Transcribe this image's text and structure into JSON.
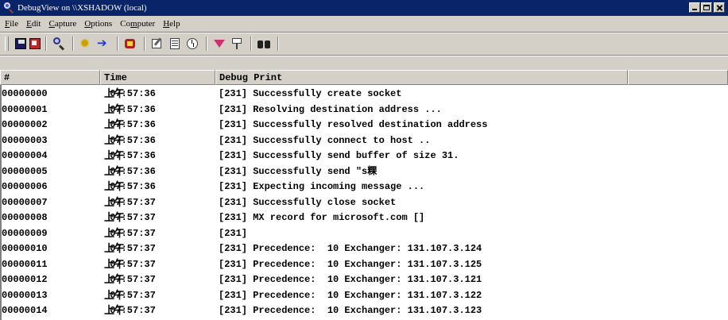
{
  "window": {
    "title": "DebugView on \\\\XSHADOW (local)"
  },
  "menu": [
    {
      "accel": "F",
      "rest": "ile"
    },
    {
      "accel": "E",
      "rest": "dit"
    },
    {
      "accel": "C",
      "rest": "apture"
    },
    {
      "accel": "O",
      "rest": "ptions"
    },
    {
      "pre": "Co",
      "accel": "m",
      "rest": "puter"
    },
    {
      "accel": "H",
      "rest": "elp"
    }
  ],
  "toolbar": {
    "icons": [
      "save-icon",
      "clear-display-icon",
      "find-icon",
      "capture-gear-icon",
      "capture-arrow-icon",
      "capture-kernel-icon",
      "edit-icon",
      "log-icon",
      "clock-icon",
      "filter-icon",
      "highlight-icon",
      "binoculars-icon"
    ]
  },
  "columns": {
    "num": "#",
    "time": "Time",
    "msg": "Debug Print"
  },
  "rows": [
    {
      "num": "00000000",
      "ampm": "上午",
      "time": "07:57:36",
      "msg": "[231] Successfully create socket"
    },
    {
      "num": "00000001",
      "ampm": "上午",
      "time": "07:57:36",
      "msg": "[231] Resolving destination address ..."
    },
    {
      "num": "00000002",
      "ampm": "上午",
      "time": "07:57:36",
      "msg": "[231] Successfully resolved destination address"
    },
    {
      "num": "00000003",
      "ampm": "上午",
      "time": "07:57:36",
      "msg": "[231] Successfully connect to host .."
    },
    {
      "num": "00000004",
      "ampm": "上午",
      "time": "07:57:36",
      "msg": "[231] Successfully send buffer of size 31."
    },
    {
      "num": "00000005",
      "ampm": "上午",
      "time": "07:57:36",
      "msg": "[231] Successfully send \"s粿"
    },
    {
      "num": "00000006",
      "ampm": "上午",
      "time": "07:57:36",
      "msg": "[231] Expecting incoming message ..."
    },
    {
      "num": "00000007",
      "ampm": "上午",
      "time": "07:57:37",
      "msg": "[231] Successfully close socket"
    },
    {
      "num": "00000008",
      "ampm": "上午",
      "time": "07:57:37",
      "msg": "[231] MX record for microsoft.com []"
    },
    {
      "num": "00000009",
      "ampm": "上午",
      "time": "07:57:37",
      "msg": "[231]"
    },
    {
      "num": "00000010",
      "ampm": "上午",
      "time": "07:57:37",
      "msg": "[231] Precedence:  10 Exchanger: 131.107.3.124"
    },
    {
      "num": "00000011",
      "ampm": "上午",
      "time": "07:57:37",
      "msg": "[231] Precedence:  10 Exchanger: 131.107.3.125"
    },
    {
      "num": "00000012",
      "ampm": "上午",
      "time": "07:57:37",
      "msg": "[231] Precedence:  10 Exchanger: 131.107.3.121"
    },
    {
      "num": "00000013",
      "ampm": "上午",
      "time": "07:57:37",
      "msg": "[231] Precedence:  10 Exchanger: 131.107.3.122"
    },
    {
      "num": "00000014",
      "ampm": "上午",
      "time": "07:57:37",
      "msg": "[231] Precedence:  10 Exchanger: 131.107.3.123"
    }
  ]
}
